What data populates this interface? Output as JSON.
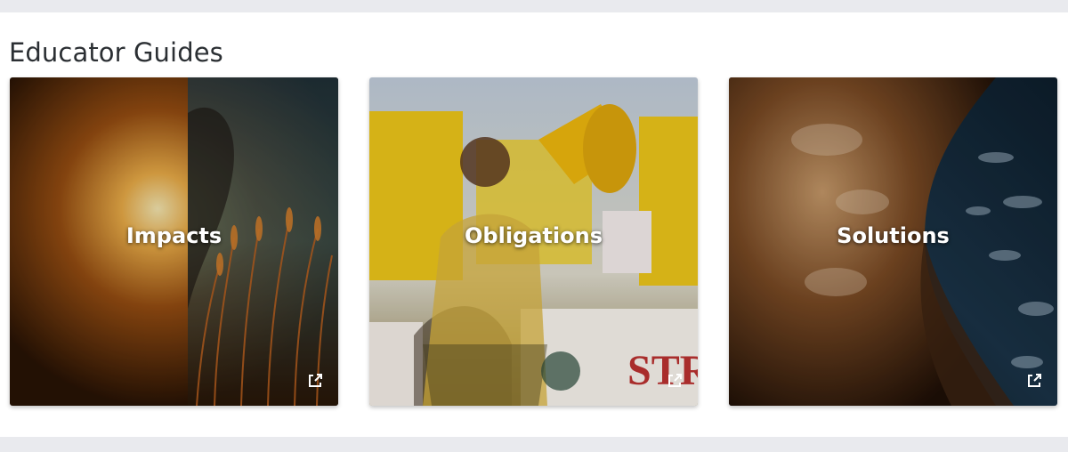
{
  "section": {
    "title": "Educator Guides"
  },
  "cards": [
    {
      "label": "Impacts",
      "icon": "external-link-icon"
    },
    {
      "label": "Obligations",
      "icon": "external-link-icon"
    },
    {
      "label": "Solutions",
      "icon": "external-link-icon"
    }
  ],
  "colors": {
    "page_background": "#e9eaee",
    "section_background": "#ffffff",
    "title_text": "#2b2f33",
    "card_label": "#ffffff"
  }
}
